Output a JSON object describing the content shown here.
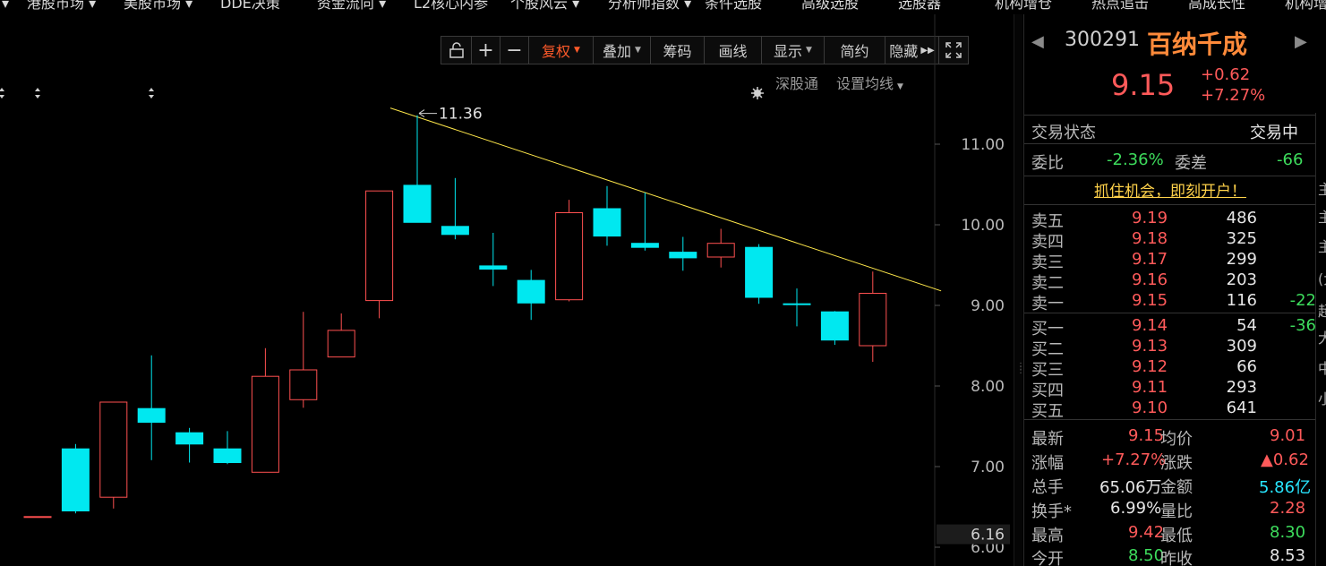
{
  "top_nav": [
    "港股市场",
    "美股市场",
    "DDE决策",
    "资金流向",
    "L2核心内参",
    "个股风云",
    "分析师指数",
    "条件选股",
    "高级选股",
    "选股器",
    "机构增仓",
    "热点追击",
    "高成长性",
    "机构增"
  ],
  "toolbar": {
    "fuquan": "复权",
    "overlay": "叠加",
    "chips": "筹码",
    "draw": "画线",
    "display": "显示",
    "simple": "简约",
    "hide": "隐藏"
  },
  "sub_tools": {
    "sz_connect": "深股通",
    "ma_settings": "设置均线"
  },
  "price_axis": {
    "ticks": [
      "11.00",
      "10.00",
      "9.00",
      "8.00",
      "7.00",
      "6.00"
    ],
    "marker": "6.16"
  },
  "annotation": {
    "high_label": "11.36"
  },
  "chart_data": {
    "type": "candlestick",
    "y_ticks": [
      11.0,
      10.0,
      9.0,
      8.0,
      7.0,
      6.0
    ],
    "candles": [
      {
        "open": 6.38,
        "close": 6.38,
        "high": 6.38,
        "low": 6.38
      },
      {
        "open": 7.22,
        "close": 6.45,
        "high": 7.28,
        "low": 6.42
      },
      {
        "open": 6.62,
        "close": 7.8,
        "high": 7.8,
        "low": 6.48
      },
      {
        "open": 7.72,
        "close": 7.55,
        "high": 8.38,
        "low": 7.08
      },
      {
        "open": 7.42,
        "close": 7.28,
        "high": 7.48,
        "low": 7.05
      },
      {
        "open": 7.22,
        "close": 7.05,
        "high": 7.44,
        "low": 7.03
      },
      {
        "open": 6.93,
        "close": 8.12,
        "high": 8.47,
        "low": 6.93
      },
      {
        "open": 7.83,
        "close": 8.2,
        "high": 8.92,
        "low": 7.73
      },
      {
        "open": 8.36,
        "close": 8.69,
        "high": 8.9,
        "low": 8.36
      },
      {
        "open": 9.06,
        "close": 10.42,
        "high": 10.42,
        "low": 8.84
      },
      {
        "open": 10.49,
        "close": 10.03,
        "high": 11.36,
        "low": 10.03
      },
      {
        "open": 9.98,
        "close": 9.88,
        "high": 10.58,
        "low": 9.82
      },
      {
        "open": 9.49,
        "close": 9.45,
        "high": 9.9,
        "low": 9.24
      },
      {
        "open": 9.31,
        "close": 9.03,
        "high": 9.44,
        "low": 8.82
      },
      {
        "open": 9.07,
        "close": 10.15,
        "high": 10.31,
        "low": 9.05
      },
      {
        "open": 10.2,
        "close": 9.86,
        "high": 10.48,
        "low": 9.74
      },
      {
        "open": 9.77,
        "close": 9.72,
        "high": 10.4,
        "low": 9.68
      },
      {
        "open": 9.66,
        "close": 9.59,
        "high": 9.85,
        "low": 9.43
      },
      {
        "open": 9.6,
        "close": 9.77,
        "high": 9.95,
        "low": 9.47
      },
      {
        "open": 9.72,
        "close": 9.1,
        "high": 9.76,
        "low": 9.02
      },
      {
        "open": 9.02,
        "close": 9.01,
        "high": 9.21,
        "low": 8.74
      },
      {
        "open": 8.92,
        "close": 8.57,
        "high": 8.93,
        "low": 8.51
      },
      {
        "open": 8.5,
        "close": 9.15,
        "high": 9.42,
        "low": 8.3
      }
    ],
    "trendline": {
      "start_candle": 10,
      "start_price": 11.36,
      "end_candle": 23.8,
      "end_price": 9.18
    },
    "colors": {
      "up": "#ff5050",
      "down": "#00e8f0",
      "trend": "#ffe84a",
      "bg": "#000000"
    }
  },
  "stock": {
    "code": "300291",
    "name": "百纳千成",
    "price": "9.15",
    "change": "+0.62",
    "change_pct": "+7.27%"
  },
  "status": {
    "label": "交易状态",
    "value": "交易中"
  },
  "committee": {
    "ratio_label": "委比",
    "ratio": "-2.36%",
    "diff_label": "委差",
    "diff": "-66"
  },
  "promo": "抓住机会，即刻开户！",
  "asks": [
    {
      "label": "卖五",
      "price": "9.19",
      "vol": "486",
      "chg": ""
    },
    {
      "label": "卖四",
      "price": "9.18",
      "vol": "325",
      "chg": ""
    },
    {
      "label": "卖三",
      "price": "9.17",
      "vol": "299",
      "chg": ""
    },
    {
      "label": "卖二",
      "price": "9.16",
      "vol": "203",
      "chg": ""
    },
    {
      "label": "卖一",
      "price": "9.15",
      "vol": "116",
      "chg": "-22"
    }
  ],
  "bids": [
    {
      "label": "买一",
      "price": "9.14",
      "vol": "54",
      "chg": "-36"
    },
    {
      "label": "买二",
      "price": "9.13",
      "vol": "309",
      "chg": ""
    },
    {
      "label": "买三",
      "price": "9.12",
      "vol": "66",
      "chg": ""
    },
    {
      "label": "买四",
      "price": "9.11",
      "vol": "293",
      "chg": ""
    },
    {
      "label": "买五",
      "price": "9.10",
      "vol": "641",
      "chg": ""
    }
  ],
  "stats": {
    "latest_label": "最新",
    "latest": "9.15",
    "avg_label": "均价",
    "avg": "9.01",
    "pct_label": "涨幅",
    "pct": "+7.27%",
    "diff_label": "涨跌",
    "diff": "▲0.62",
    "vol_label": "总手",
    "vol": "65.06万",
    "amount_label": "金额",
    "amount": "5.86亿",
    "turnover_label": "换手*",
    "turnover": "6.99%",
    "vol_ratio_label": "量比",
    "vol_ratio": "2.28",
    "high_label": "最高",
    "high": "9.42",
    "low_label": "最低",
    "low": "8.30",
    "open_label": "今开",
    "open": "8.50",
    "prev_label": "昨收",
    "prev": "8.53"
  },
  "edge_fragments": [
    "主",
    "主",
    "主",
    "(大",
    "超",
    "大",
    "中",
    "小"
  ]
}
